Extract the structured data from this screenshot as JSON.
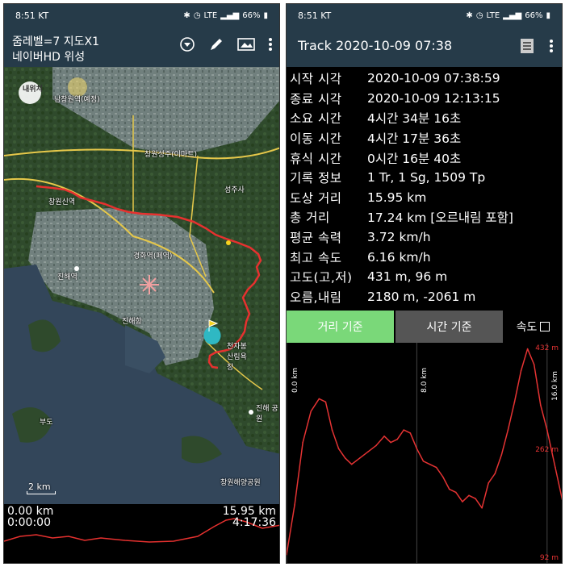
{
  "status": {
    "time": "8:51 KT",
    "battery": "66%",
    "network": "LTE"
  },
  "left": {
    "toolbar": {
      "line1": "줌레벨=7 지도X1",
      "line2": "네이버HD 위성"
    },
    "icons": [
      "dropdown-icon",
      "pencil-icon",
      "map-layers-icon",
      "more-icon"
    ],
    "map": {
      "my_location_label": "내위치",
      "labels": {
        "l1": "남창원역(예정)",
        "l2": "창원성주(이마트)",
        "l3": "성주사",
        "l4": "창원신역",
        "l5": "경화역(폐역)",
        "l6": "진해역",
        "l7": "진해항",
        "l8": "천자봉 산림욕장",
        "l9": "부도",
        "l10": "진해 공원",
        "l11": "창원해양공원"
      },
      "scale_label": "2 km"
    },
    "mini_profile": {
      "start_distance": "0.00 km",
      "start_time": "0:00:00",
      "end_distance": "15.95 km",
      "end_time": "4:17:36"
    }
  },
  "right": {
    "toolbar": {
      "title": "Track 2020-10-09 07:38"
    },
    "icons": [
      "list-icon",
      "more-icon"
    ],
    "stats": [
      {
        "label": "시작 시각",
        "value": "2020-10-09 07:38:59"
      },
      {
        "label": "종료 시각",
        "value": "2020-10-09 12:13:15"
      },
      {
        "label": "소요 시간",
        "value": "4시간 34분 16초"
      },
      {
        "label": "이동 시간",
        "value": "4시간 17분 36초"
      },
      {
        "label": "휴식 시간",
        "value": "0시간 16분 40초"
      },
      {
        "label": "기록 정보",
        "value": "1 Tr, 1 Sg, 1509 Tp"
      },
      {
        "label": "도상 거리",
        "value": "15.95 km"
      },
      {
        "label": "총 거리",
        "value": "17.24 km [오르내림 포함]"
      },
      {
        "label": "평균 속력",
        "value": "3.72 km/h"
      },
      {
        "label": "최고 속도",
        "value": "6.16 km/h"
      },
      {
        "label": "고도(고,저)",
        "value": "431 m, 96 m"
      },
      {
        "label": "오름,내림",
        "value": "2180 m, -2061 m"
      }
    ],
    "tabs": {
      "distance": "거리 기준",
      "time": "시간 기준",
      "speed": "속도"
    },
    "chart_labels": {
      "max": "432 m",
      "mid": "262 m",
      "min": "92 m",
      "x0": "0.0 km",
      "x1": "8.0 km",
      "x2": "16.0 km"
    }
  },
  "chart_data": {
    "type": "line",
    "title": "",
    "xlabel": "",
    "ylabel": "",
    "ylim": [
      92,
      432
    ],
    "x_ticks": [
      "0.0 km",
      "8.0 km",
      "16.0 km"
    ],
    "y_labels": [
      "432 m",
      "262 m",
      "92 m"
    ],
    "series": [
      {
        "color": "#e53333",
        "x": [
          0,
          0.5,
          1.0,
          1.5,
          2.0,
          2.4,
          2.8,
          3.2,
          3.6,
          4.0,
          4.5,
          5.0,
          5.5,
          6.0,
          6.4,
          6.8,
          7.2,
          7.6,
          8.0,
          8.4,
          8.8,
          9.2,
          9.6,
          10.0,
          10.4,
          10.8,
          11.2,
          11.6,
          12.0,
          12.4,
          12.8,
          13.2,
          13.6,
          14.0,
          14.4,
          14.8,
          15.2,
          15.6,
          16.0,
          16.5,
          17.0
        ],
        "y": [
          100,
          180,
          280,
          330,
          350,
          345,
          300,
          270,
          255,
          245,
          255,
          265,
          275,
          290,
          280,
          285,
          300,
          295,
          270,
          250,
          245,
          240,
          225,
          205,
          200,
          185,
          195,
          190,
          175,
          215,
          230,
          260,
          300,
          345,
          395,
          430,
          405,
          340,
          300,
          240,
          180
        ]
      }
    ]
  }
}
